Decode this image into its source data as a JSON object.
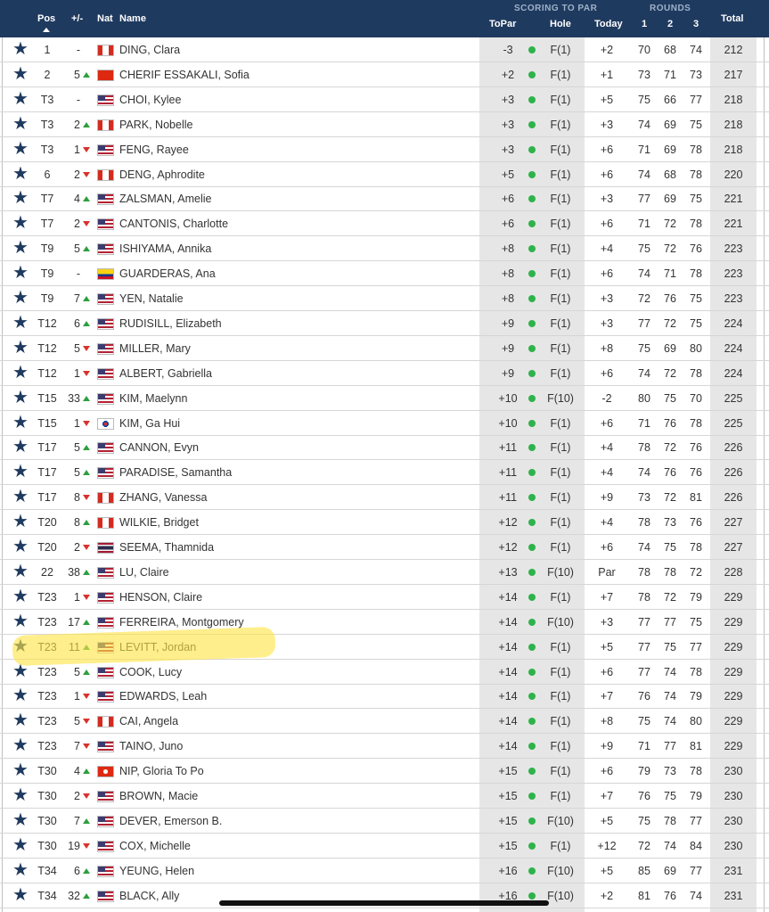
{
  "header": {
    "pos": "Pos",
    "chg": "+/-",
    "nat": "Nat",
    "name": "Name",
    "scoring_group": "SCORING TO PAR",
    "topar": "ToPar",
    "hole": "Hole",
    "today": "Today",
    "rounds_group": "ROUNDS",
    "r1": "1",
    "r2": "2",
    "r3": "3",
    "total": "Total"
  },
  "colors": {
    "header_bg": "#1f3a5f",
    "up_arrow": "#2e9e3e",
    "down_arrow": "#d9322b",
    "status_dot": "#2eb34a",
    "highlight": "#ffe446"
  },
  "rows": [
    {
      "pos": "1",
      "chg": "-",
      "dir": "none",
      "flag": "ca",
      "name": "DING, Clara",
      "topar": "-3",
      "hole": "F(1)",
      "today": "+2",
      "r1": "70",
      "r2": "68",
      "r3": "74",
      "total": "212"
    },
    {
      "pos": "2",
      "chg": "5",
      "dir": "up",
      "flag": "cn",
      "name": "CHERIF ESSAKALI, Sofia",
      "topar": "+2",
      "hole": "F(1)",
      "today": "+1",
      "r1": "73",
      "r2": "71",
      "r3": "73",
      "total": "217"
    },
    {
      "pos": "T3",
      "chg": "-",
      "dir": "none",
      "flag": "us",
      "name": "CHOI, Kylee",
      "topar": "+3",
      "hole": "F(1)",
      "today": "+5",
      "r1": "75",
      "r2": "66",
      "r3": "77",
      "total": "218"
    },
    {
      "pos": "T3",
      "chg": "2",
      "dir": "up",
      "flag": "ca",
      "name": "PARK, Nobelle",
      "topar": "+3",
      "hole": "F(1)",
      "today": "+3",
      "r1": "74",
      "r2": "69",
      "r3": "75",
      "total": "218"
    },
    {
      "pos": "T3",
      "chg": "1",
      "dir": "down",
      "flag": "us",
      "name": "FENG, Rayee",
      "topar": "+3",
      "hole": "F(1)",
      "today": "+6",
      "r1": "71",
      "r2": "69",
      "r3": "78",
      "total": "218"
    },
    {
      "pos": "6",
      "chg": "2",
      "dir": "down",
      "flag": "ca",
      "name": "DENG, Aphrodite",
      "topar": "+5",
      "hole": "F(1)",
      "today": "+6",
      "r1": "74",
      "r2": "68",
      "r3": "78",
      "total": "220"
    },
    {
      "pos": "T7",
      "chg": "4",
      "dir": "up",
      "flag": "us",
      "name": "ZALSMAN, Amelie",
      "topar": "+6",
      "hole": "F(1)",
      "today": "+3",
      "r1": "77",
      "r2": "69",
      "r3": "75",
      "total": "221"
    },
    {
      "pos": "T7",
      "chg": "2",
      "dir": "down",
      "flag": "us",
      "name": "CANTONIS, Charlotte",
      "topar": "+6",
      "hole": "F(1)",
      "today": "+6",
      "r1": "71",
      "r2": "72",
      "r3": "78",
      "total": "221"
    },
    {
      "pos": "T9",
      "chg": "5",
      "dir": "up",
      "flag": "us",
      "name": "ISHIYAMA, Annika",
      "topar": "+8",
      "hole": "F(1)",
      "today": "+4",
      "r1": "75",
      "r2": "72",
      "r3": "76",
      "total": "223"
    },
    {
      "pos": "T9",
      "chg": "-",
      "dir": "none",
      "flag": "co",
      "name": "GUARDERAS, Ana",
      "topar": "+8",
      "hole": "F(1)",
      "today": "+6",
      "r1": "74",
      "r2": "71",
      "r3": "78",
      "total": "223"
    },
    {
      "pos": "T9",
      "chg": "7",
      "dir": "up",
      "flag": "us",
      "name": "YEN, Natalie",
      "topar": "+8",
      "hole": "F(1)",
      "today": "+3",
      "r1": "72",
      "r2": "76",
      "r3": "75",
      "total": "223"
    },
    {
      "pos": "T12",
      "chg": "6",
      "dir": "up",
      "flag": "us",
      "name": "RUDISILL, Elizabeth",
      "topar": "+9",
      "hole": "F(1)",
      "today": "+3",
      "r1": "77",
      "r2": "72",
      "r3": "75",
      "total": "224"
    },
    {
      "pos": "T12",
      "chg": "5",
      "dir": "down",
      "flag": "us",
      "name": "MILLER, Mary",
      "topar": "+9",
      "hole": "F(1)",
      "today": "+8",
      "r1": "75",
      "r2": "69",
      "r3": "80",
      "total": "224"
    },
    {
      "pos": "T12",
      "chg": "1",
      "dir": "down",
      "flag": "us",
      "name": "ALBERT, Gabriella",
      "topar": "+9",
      "hole": "F(1)",
      "today": "+6",
      "r1": "74",
      "r2": "72",
      "r3": "78",
      "total": "224"
    },
    {
      "pos": "T15",
      "chg": "33",
      "dir": "up",
      "flag": "us",
      "name": "KIM, Maelynn",
      "topar": "+10",
      "hole": "F(10)",
      "today": "-2",
      "r1": "80",
      "r2": "75",
      "r3": "70",
      "total": "225"
    },
    {
      "pos": "T15",
      "chg": "1",
      "dir": "down",
      "flag": "kr",
      "name": "KIM, Ga Hui",
      "topar": "+10",
      "hole": "F(1)",
      "today": "+6",
      "r1": "71",
      "r2": "76",
      "r3": "78",
      "total": "225"
    },
    {
      "pos": "T17",
      "chg": "5",
      "dir": "up",
      "flag": "us",
      "name": "CANNON, Evyn",
      "topar": "+11",
      "hole": "F(1)",
      "today": "+4",
      "r1": "78",
      "r2": "72",
      "r3": "76",
      "total": "226"
    },
    {
      "pos": "T17",
      "chg": "5",
      "dir": "up",
      "flag": "us",
      "name": "PARADISE, Samantha",
      "topar": "+11",
      "hole": "F(1)",
      "today": "+4",
      "r1": "74",
      "r2": "76",
      "r3": "76",
      "total": "226"
    },
    {
      "pos": "T17",
      "chg": "8",
      "dir": "down",
      "flag": "ca",
      "name": "ZHANG, Vanessa",
      "topar": "+11",
      "hole": "F(1)",
      "today": "+9",
      "r1": "73",
      "r2": "72",
      "r3": "81",
      "total": "226"
    },
    {
      "pos": "T20",
      "chg": "8",
      "dir": "up",
      "flag": "ca",
      "name": "WILKIE, Bridget",
      "topar": "+12",
      "hole": "F(1)",
      "today": "+4",
      "r1": "78",
      "r2": "73",
      "r3": "76",
      "total": "227"
    },
    {
      "pos": "T20",
      "chg": "2",
      "dir": "down",
      "flag": "th",
      "name": "SEEMA, Thamnida",
      "topar": "+12",
      "hole": "F(1)",
      "today": "+6",
      "r1": "74",
      "r2": "75",
      "r3": "78",
      "total": "227"
    },
    {
      "pos": "22",
      "chg": "38",
      "dir": "up",
      "flag": "us",
      "name": "LU, Claire",
      "topar": "+13",
      "hole": "F(10)",
      "today": "Par",
      "r1": "78",
      "r2": "78",
      "r3": "72",
      "total": "228"
    },
    {
      "pos": "T23",
      "chg": "1",
      "dir": "down",
      "flag": "us",
      "name": "HENSON, Claire",
      "topar": "+14",
      "hole": "F(1)",
      "today": "+7",
      "r1": "78",
      "r2": "72",
      "r3": "79",
      "total": "229"
    },
    {
      "pos": "T23",
      "chg": "17",
      "dir": "up",
      "flag": "us",
      "name": "FERREIRA, Montgomery",
      "topar": "+14",
      "hole": "F(10)",
      "today": "+3",
      "r1": "77",
      "r2": "77",
      "r3": "75",
      "total": "229"
    },
    {
      "pos": "T23",
      "chg": "11",
      "dir": "up",
      "flag": "us",
      "name": "LEVITT, Jordan",
      "topar": "+14",
      "hole": "F(1)",
      "today": "+5",
      "r1": "77",
      "r2": "75",
      "r3": "77",
      "total": "229"
    },
    {
      "pos": "T23",
      "chg": "5",
      "dir": "up",
      "flag": "us",
      "name": "COOK, Lucy",
      "topar": "+14",
      "hole": "F(1)",
      "today": "+6",
      "r1": "77",
      "r2": "74",
      "r3": "78",
      "total": "229"
    },
    {
      "pos": "T23",
      "chg": "1",
      "dir": "down",
      "flag": "us",
      "name": "EDWARDS, Leah",
      "topar": "+14",
      "hole": "F(1)",
      "today": "+7",
      "r1": "76",
      "r2": "74",
      "r3": "79",
      "total": "229"
    },
    {
      "pos": "T23",
      "chg": "5",
      "dir": "down",
      "flag": "ca",
      "name": "CAI, Angela",
      "topar": "+14",
      "hole": "F(1)",
      "today": "+8",
      "r1": "75",
      "r2": "74",
      "r3": "80",
      "total": "229"
    },
    {
      "pos": "T23",
      "chg": "7",
      "dir": "down",
      "flag": "us",
      "name": "TAINO, Juno",
      "topar": "+14",
      "hole": "F(1)",
      "today": "+9",
      "r1": "71",
      "r2": "77",
      "r3": "81",
      "total": "229"
    },
    {
      "pos": "T30",
      "chg": "4",
      "dir": "up",
      "flag": "hk",
      "name": "NIP, Gloria To Po",
      "topar": "+15",
      "hole": "F(1)",
      "today": "+6",
      "r1": "79",
      "r2": "73",
      "r3": "78",
      "total": "230"
    },
    {
      "pos": "T30",
      "chg": "2",
      "dir": "down",
      "flag": "us",
      "name": "BROWN, Macie",
      "topar": "+15",
      "hole": "F(1)",
      "today": "+7",
      "r1": "76",
      "r2": "75",
      "r3": "79",
      "total": "230"
    },
    {
      "pos": "T30",
      "chg": "7",
      "dir": "up",
      "flag": "us",
      "name": "DEVER, Emerson B.",
      "topar": "+15",
      "hole": "F(10)",
      "today": "+5",
      "r1": "75",
      "r2": "78",
      "r3": "77",
      "total": "230"
    },
    {
      "pos": "T30",
      "chg": "19",
      "dir": "down",
      "flag": "us",
      "name": "COX, Michelle",
      "topar": "+15",
      "hole": "F(1)",
      "today": "+12",
      "r1": "72",
      "r2": "74",
      "r3": "84",
      "total": "230"
    },
    {
      "pos": "T34",
      "chg": "6",
      "dir": "up",
      "flag": "us",
      "name": "YEUNG, Helen",
      "topar": "+16",
      "hole": "F(10)",
      "today": "+5",
      "r1": "85",
      "r2": "69",
      "r3": "77",
      "total": "231"
    },
    {
      "pos": "T34",
      "chg": "32",
      "dir": "up",
      "flag": "us",
      "name": "BLACK, Ally",
      "topar": "+16",
      "hole": "F(10)",
      "today": "+2",
      "r1": "81",
      "r2": "76",
      "r3": "74",
      "total": "231"
    }
  ]
}
